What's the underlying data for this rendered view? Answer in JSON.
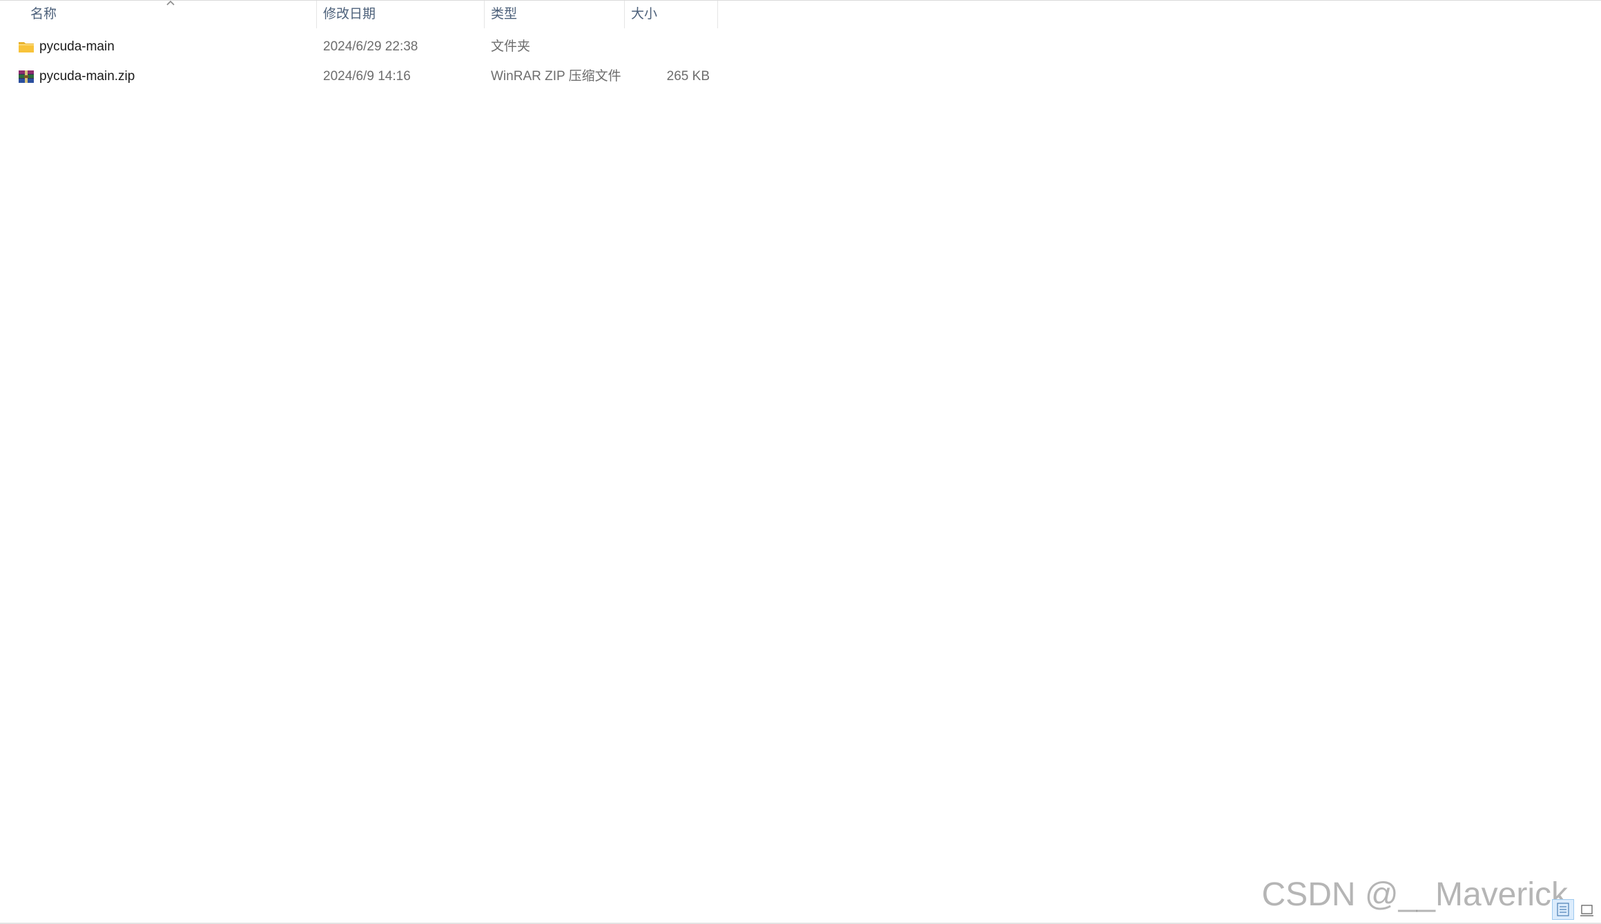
{
  "columns": {
    "name": "名称",
    "date": "修改日期",
    "type": "类型",
    "size": "大小"
  },
  "sort": {
    "column": "name",
    "icon": "chevron-up-icon"
  },
  "files": [
    {
      "name": "pycuda-main",
      "date": "2024/6/29 22:38",
      "type": "文件夹",
      "size": "",
      "icon": "folder-icon"
    },
    {
      "name": "pycuda-main.zip",
      "date": "2024/6/9 14:16",
      "type": "WinRAR ZIP 压缩文件",
      "size": "265 KB",
      "icon": "winrar-archive-icon"
    }
  ],
  "watermark": "CSDN @__Maverick",
  "view_buttons": {
    "details_icon": "details-view-icon",
    "large_icons_icon": "large-icons-view-icon"
  },
  "colors": {
    "header_text": "#4c607a",
    "name_text": "#1b1b1b",
    "meta_text": "#6d6d6d",
    "folder": "#f8c33a",
    "selected_view_bg": "#dcecfc"
  }
}
